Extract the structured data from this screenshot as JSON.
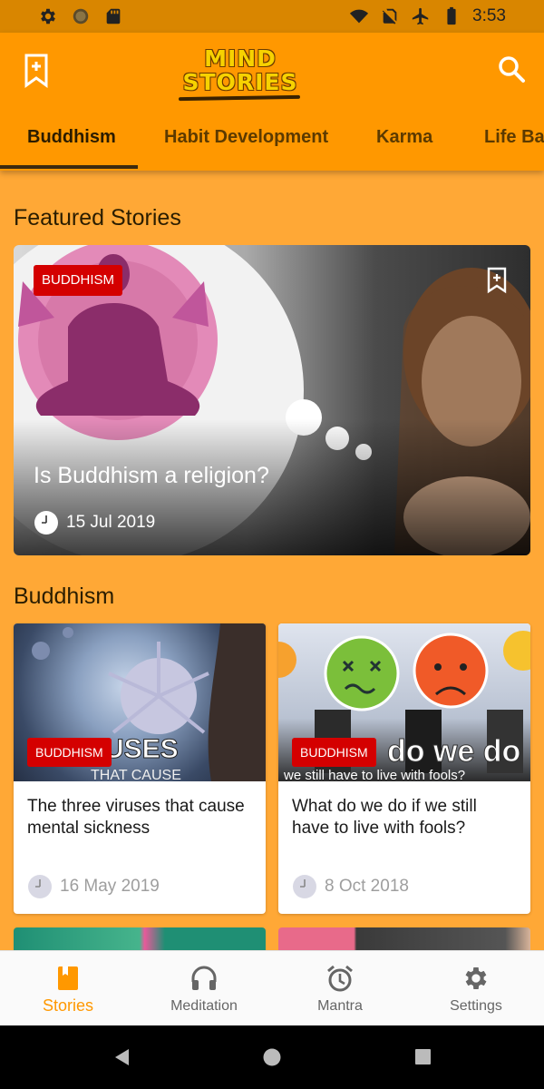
{
  "status_bar": {
    "time": "3:53"
  },
  "app_bar": {
    "logo_line1": "MIND",
    "logo_line2": "STORIES",
    "tabs": [
      "Buddhism",
      "Habit Development",
      "Karma",
      "Life Bal"
    ]
  },
  "featured": {
    "section_title": "Featured Stories",
    "badge": "BUDDHISM",
    "title": "Is Buddhism a religion?",
    "date": "15 Jul 2019"
  },
  "buddhism_section": {
    "title": "Buddhism",
    "cards": [
      {
        "badge": "BUDDHISM",
        "title": "The three viruses that cause mental sickness",
        "date": "16 May 2019",
        "image_text_big": "IRUSES",
        "image_text_small": "THAT CAUSE"
      },
      {
        "badge": "BUDDHISM",
        "title": "What do we do if we still have to live with fools?",
        "date": "8 Oct 2018",
        "image_text_big": "do we do",
        "image_text_small": "we still have to live with fools?"
      }
    ]
  },
  "bottom_nav": {
    "items": [
      "Stories",
      "Meditation",
      "Mantra",
      "Settings"
    ],
    "active": "Stories"
  },
  "colors": {
    "primary": "#ff9800",
    "background": "#ffa836",
    "badge": "#d40000"
  }
}
